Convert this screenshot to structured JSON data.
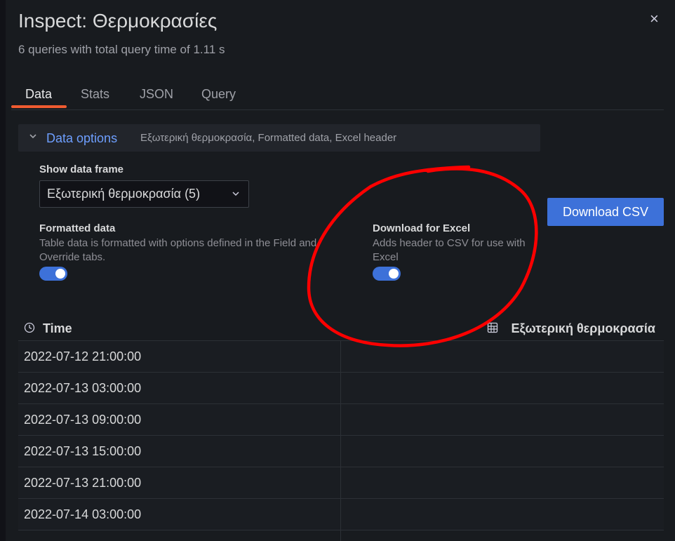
{
  "header": {
    "title": "Inspect: Θερμοκρασίες",
    "subtitle": "6 queries with total query time of 1.11 s",
    "close_glyph": "×"
  },
  "tabs": [
    {
      "label": "Data",
      "active": true
    },
    {
      "label": "Stats",
      "active": false
    },
    {
      "label": "JSON",
      "active": false
    },
    {
      "label": "Query",
      "active": false
    }
  ],
  "data_options": {
    "title": "Data options",
    "summary": "Εξωτερική θερμοκρασία, Formatted data, Excel header",
    "show_frame_label": "Show data frame",
    "frame_selected": "Εξωτερική θερμοκρασία (5)",
    "formatted": {
      "label": "Formatted data",
      "desc_line1": "Table data is formatted with options defined in the Field and",
      "desc_line2": "Override tabs.",
      "on": true
    },
    "excel": {
      "label": "Download for Excel",
      "desc_line1": "Adds header to CSV for use with",
      "desc_line2": "Excel",
      "on": true
    },
    "download_label": "Download CSV"
  },
  "table": {
    "columns": [
      "Time",
      "Εξωτερική θερμοκρασία"
    ],
    "rows": [
      [
        "2022-07-12 21:00:00",
        ""
      ],
      [
        "2022-07-13 03:00:00",
        ""
      ],
      [
        "2022-07-13 09:00:00",
        ""
      ],
      [
        "2022-07-13 15:00:00",
        ""
      ],
      [
        "2022-07-13 21:00:00",
        ""
      ],
      [
        "2022-07-14 03:00:00",
        ""
      ]
    ]
  },
  "colors": {
    "accent": "#3d71d9",
    "tab_underline": "#ef5b30",
    "link": "#6e9fff",
    "annotation": "#ff0000"
  },
  "icons": [
    "close-icon",
    "chevron-down-icon",
    "clock-icon",
    "table-icon"
  ]
}
